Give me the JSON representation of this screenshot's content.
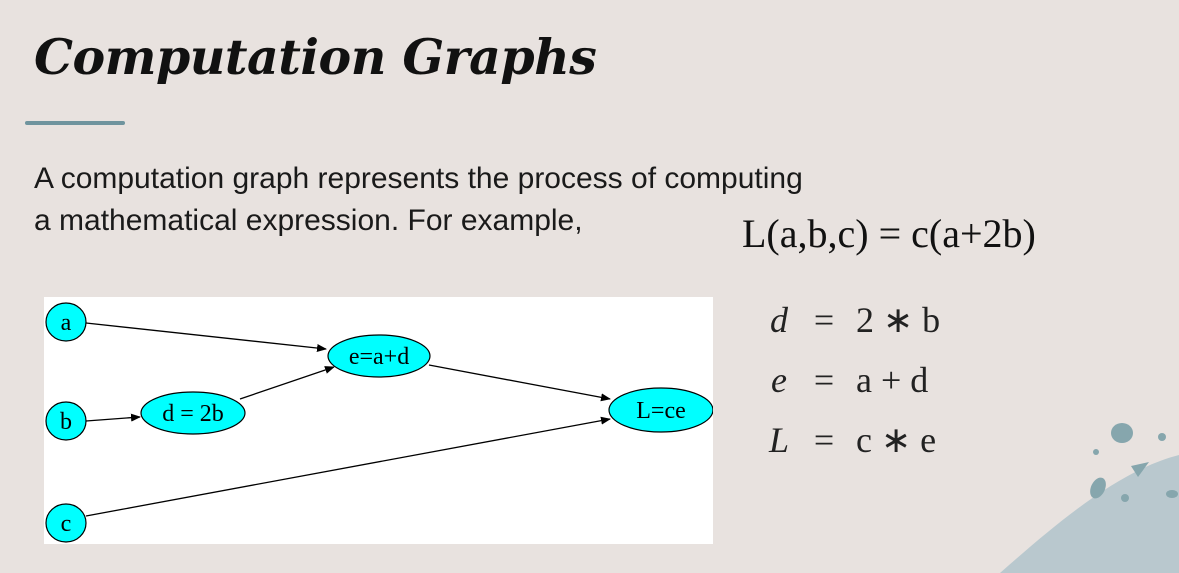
{
  "slide": {
    "title": "Computation Graphs",
    "body_line1": "A computation graph represents the process of computing",
    "body_line2": "a mathematical expression. For example,",
    "formula": "L(a,b,c) = c(a+2b)"
  },
  "graph": {
    "nodes": {
      "a": "a",
      "b": "b",
      "c": "c",
      "d": "d = 2b",
      "e": "e=a+d",
      "L": "L=ce"
    }
  },
  "equations": [
    {
      "lhs": "d",
      "op": "=",
      "rhs": "2 ∗ b"
    },
    {
      "lhs": "e",
      "op": "=",
      "rhs": "a + d"
    },
    {
      "lhs": "L",
      "op": "=",
      "rhs": "c ∗ e"
    }
  ],
  "colors": {
    "background": "#e8e2df",
    "node_fill": "#00ffff",
    "accent_rule": "#6f949e",
    "decoration": "#b9c8ce"
  }
}
